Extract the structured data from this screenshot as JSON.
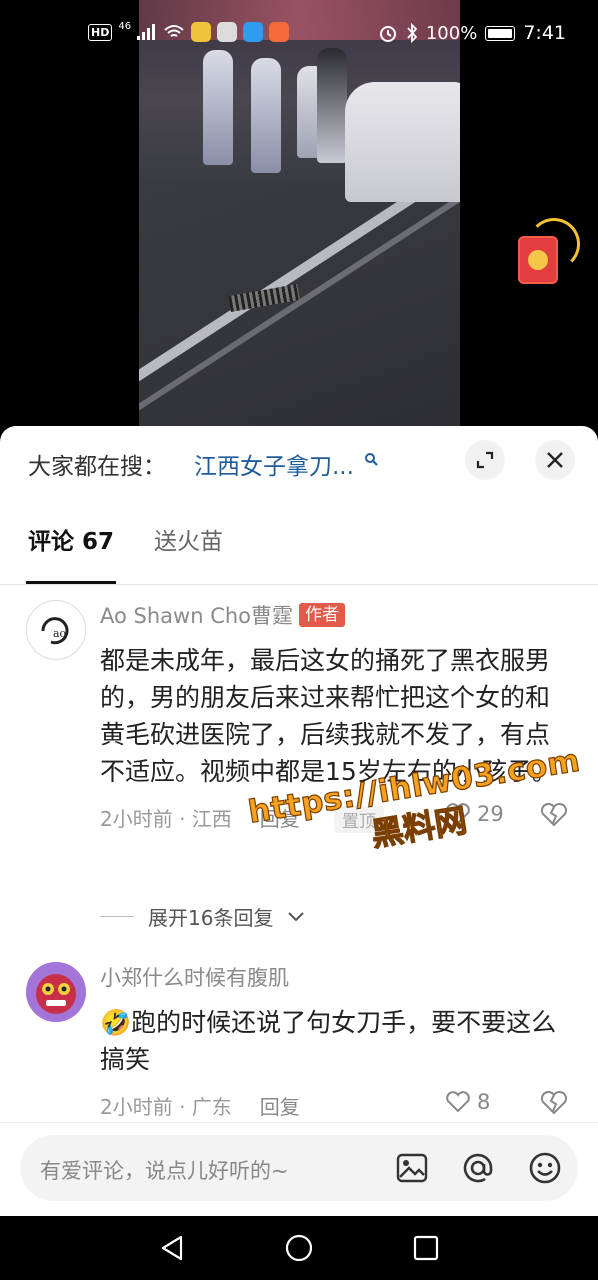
{
  "status_bar": {
    "hd": "HD",
    "signal": "46",
    "battery": "100%",
    "time": "7:41"
  },
  "search_bar": {
    "label": "大家都在搜：",
    "term": "江西女子拿刀..."
  },
  "tabs": [
    {
      "label": "评论 67",
      "active": true
    },
    {
      "label": "送火苗",
      "active": false
    }
  ],
  "comments": [
    {
      "author": "Ao Shawn Cho曹霆",
      "badge": "作者",
      "text": "都是未成年，最后这女的捅死了黑衣服男的，男的朋友后来过来帮忙把这个女的和黄毛砍进医院了，后续我就不发了，有点不适应。视频中都是15岁左右的小孩子。",
      "partial_tag": "置顶",
      "time_location": "2小时前 · 江西",
      "reply_label": "回复",
      "likes": "29",
      "expand_replies": "展开16条回复"
    },
    {
      "author": "小郑什么时候有腹肌",
      "emoji": "🤣",
      "text": "跑的时候还说了句女刀手，要不要这么搞笑",
      "time_location": "2小时前 · 广东",
      "reply_label": "回复",
      "likes": "8"
    }
  ],
  "input": {
    "placeholder": "有爱评论，说点儿好听的~"
  },
  "watermark": {
    "url": "https://ihlw03.com",
    "name": "黑料网"
  },
  "colors": {
    "search_term": "#1e5c9c",
    "author_badge": "#e25a4a",
    "watermark": "#f6a21e"
  }
}
